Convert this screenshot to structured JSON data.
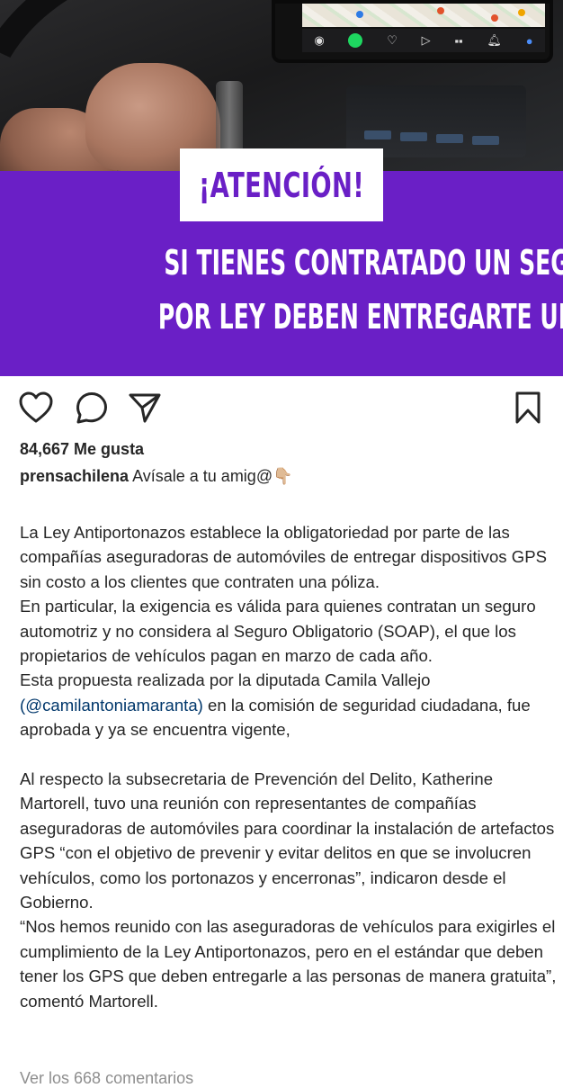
{
  "post": {
    "image": {
      "attention": "¡ATENCIÓN!",
      "headline_line1": "SI TIENES CONTRATADO UN SEGURO AUTOMOTRIZ",
      "headline_line2": "POR LEY DEBEN ENTREGARTE UN GPS GRATUITO",
      "banner_color": "#6a1fc6"
    },
    "actions": {
      "like_icon": "heart-icon",
      "comment_icon": "comment-icon",
      "share_icon": "paper-plane-icon",
      "save_icon": "bookmark-icon"
    },
    "likes_label": "84,667 Me gusta",
    "username": "prensachilena",
    "caption_intro": "Avísale a tu amig@👇🏼",
    "paragraphs": [
      "La Ley Antiportonazos establece la obligatoriedad por parte de las compañías aseguradoras de automóviles de entregar dispositivos GPS sin costo a los clientes que contraten una póliza.",
      "En particular, la exigencia es válida para quienes contratan un seguro automotriz y no considera al Seguro Obligatorio (SOAP), el que los propietarios de vehículos pagan en marzo de cada año.",
      "Esta propuesta  realizada por la diputada  Camila Vallejo",
      "en la comisión de seguridad ciudadana, fue aprobada y  ya se encuentra vigente,",
      "Al respecto la  subsecretaria de Prevención del Delito, Katherine Martorell, tuvo una reunión con representantes de compañías aseguradoras de automóviles para coordinar la instalación de artefactos GPS “con el objetivo de prevenir y evitar delitos en que se involucren vehículos, como los portonazos y encerronas”, indicaron desde el Gobierno.",
      "“Nos hemos reunido con las aseguradoras de vehículos para exigirles el cumplimiento de la Ley Antiportonazos, pero en el estándar que deben tener los GPS que deben entregarle a las personas de manera gratuita”, comentó Martorell."
    ],
    "mention": "(@camilantoniamaranta)",
    "comments_link": "Ver los 668 comentarios"
  }
}
